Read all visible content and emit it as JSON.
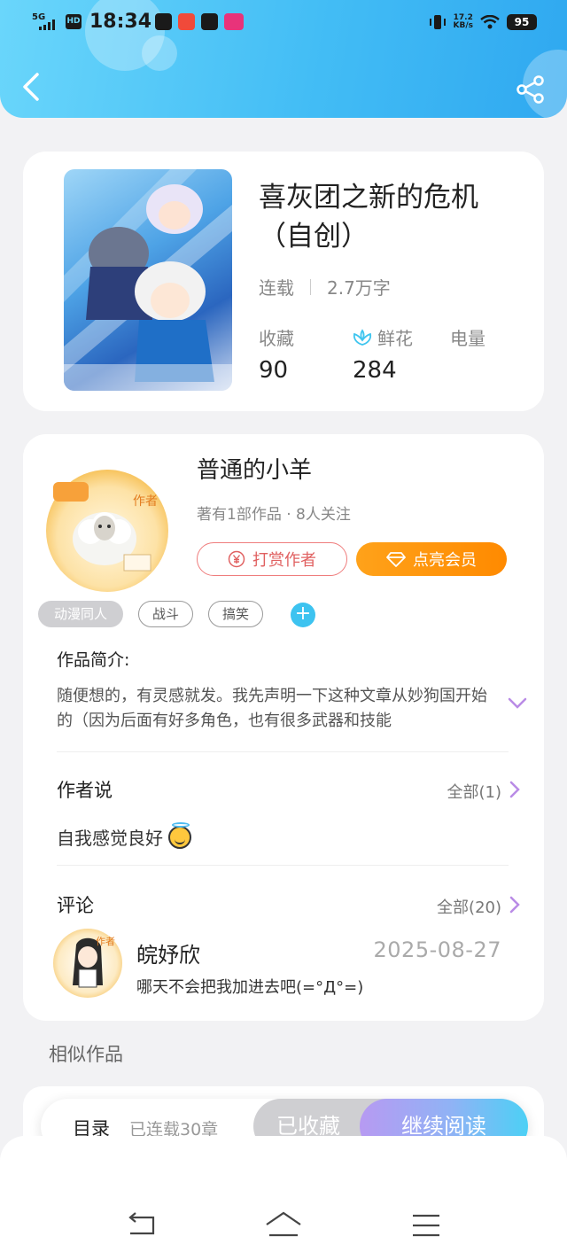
{
  "status_bar": {
    "time": "18:34",
    "network": "5G",
    "hd": "HD",
    "speed": "17.2",
    "speed_unit": "KB/s",
    "battery": "95"
  },
  "header": {
    "back_icon": "chevron-left-icon",
    "share_icon": "share-icon"
  },
  "book": {
    "title": "喜灰团之新的危机（自创）",
    "status": "连载",
    "word_count": "2.7万字",
    "stats": [
      {
        "label": "收藏",
        "value": "90"
      },
      {
        "label": "鲜花",
        "value": "284"
      },
      {
        "label": "电量",
        "value": ""
      }
    ]
  },
  "author": {
    "name": "普通的小羊",
    "meta": "著有1部作品 · 8人关注",
    "tip_button": "打赏作者",
    "vip_button": "点亮会员",
    "tags": [
      "动漫同人",
      "战斗",
      "搞笑"
    ],
    "add_tag": "+"
  },
  "intro": {
    "heading": "作品简介:",
    "text": "随便想的，有灵感就发。我先声明一下这种文章从妙狗国开始的（因为后面有好多角色，也有很多武器和技能"
  },
  "author_says": {
    "heading": "作者说",
    "all_label": "全部(1)",
    "text": "自我感觉良好"
  },
  "comments": {
    "heading": "评论",
    "all_label": "全部(20)",
    "items": [
      {
        "name": "皖妤欣",
        "date": "2025-08-27",
        "text": "哪天不会把我加进去吧(=°Д°=)"
      }
    ]
  },
  "similar": {
    "heading": "相似作品"
  },
  "bottom_bar": {
    "toc_label": "目录",
    "toc_count": "已连载30章",
    "collected_label": "已收藏",
    "continue_label": "继续阅读"
  },
  "nav": {
    "back": "back-arrow-icon",
    "home": "home-icon",
    "menu": "menu-icon"
  }
}
